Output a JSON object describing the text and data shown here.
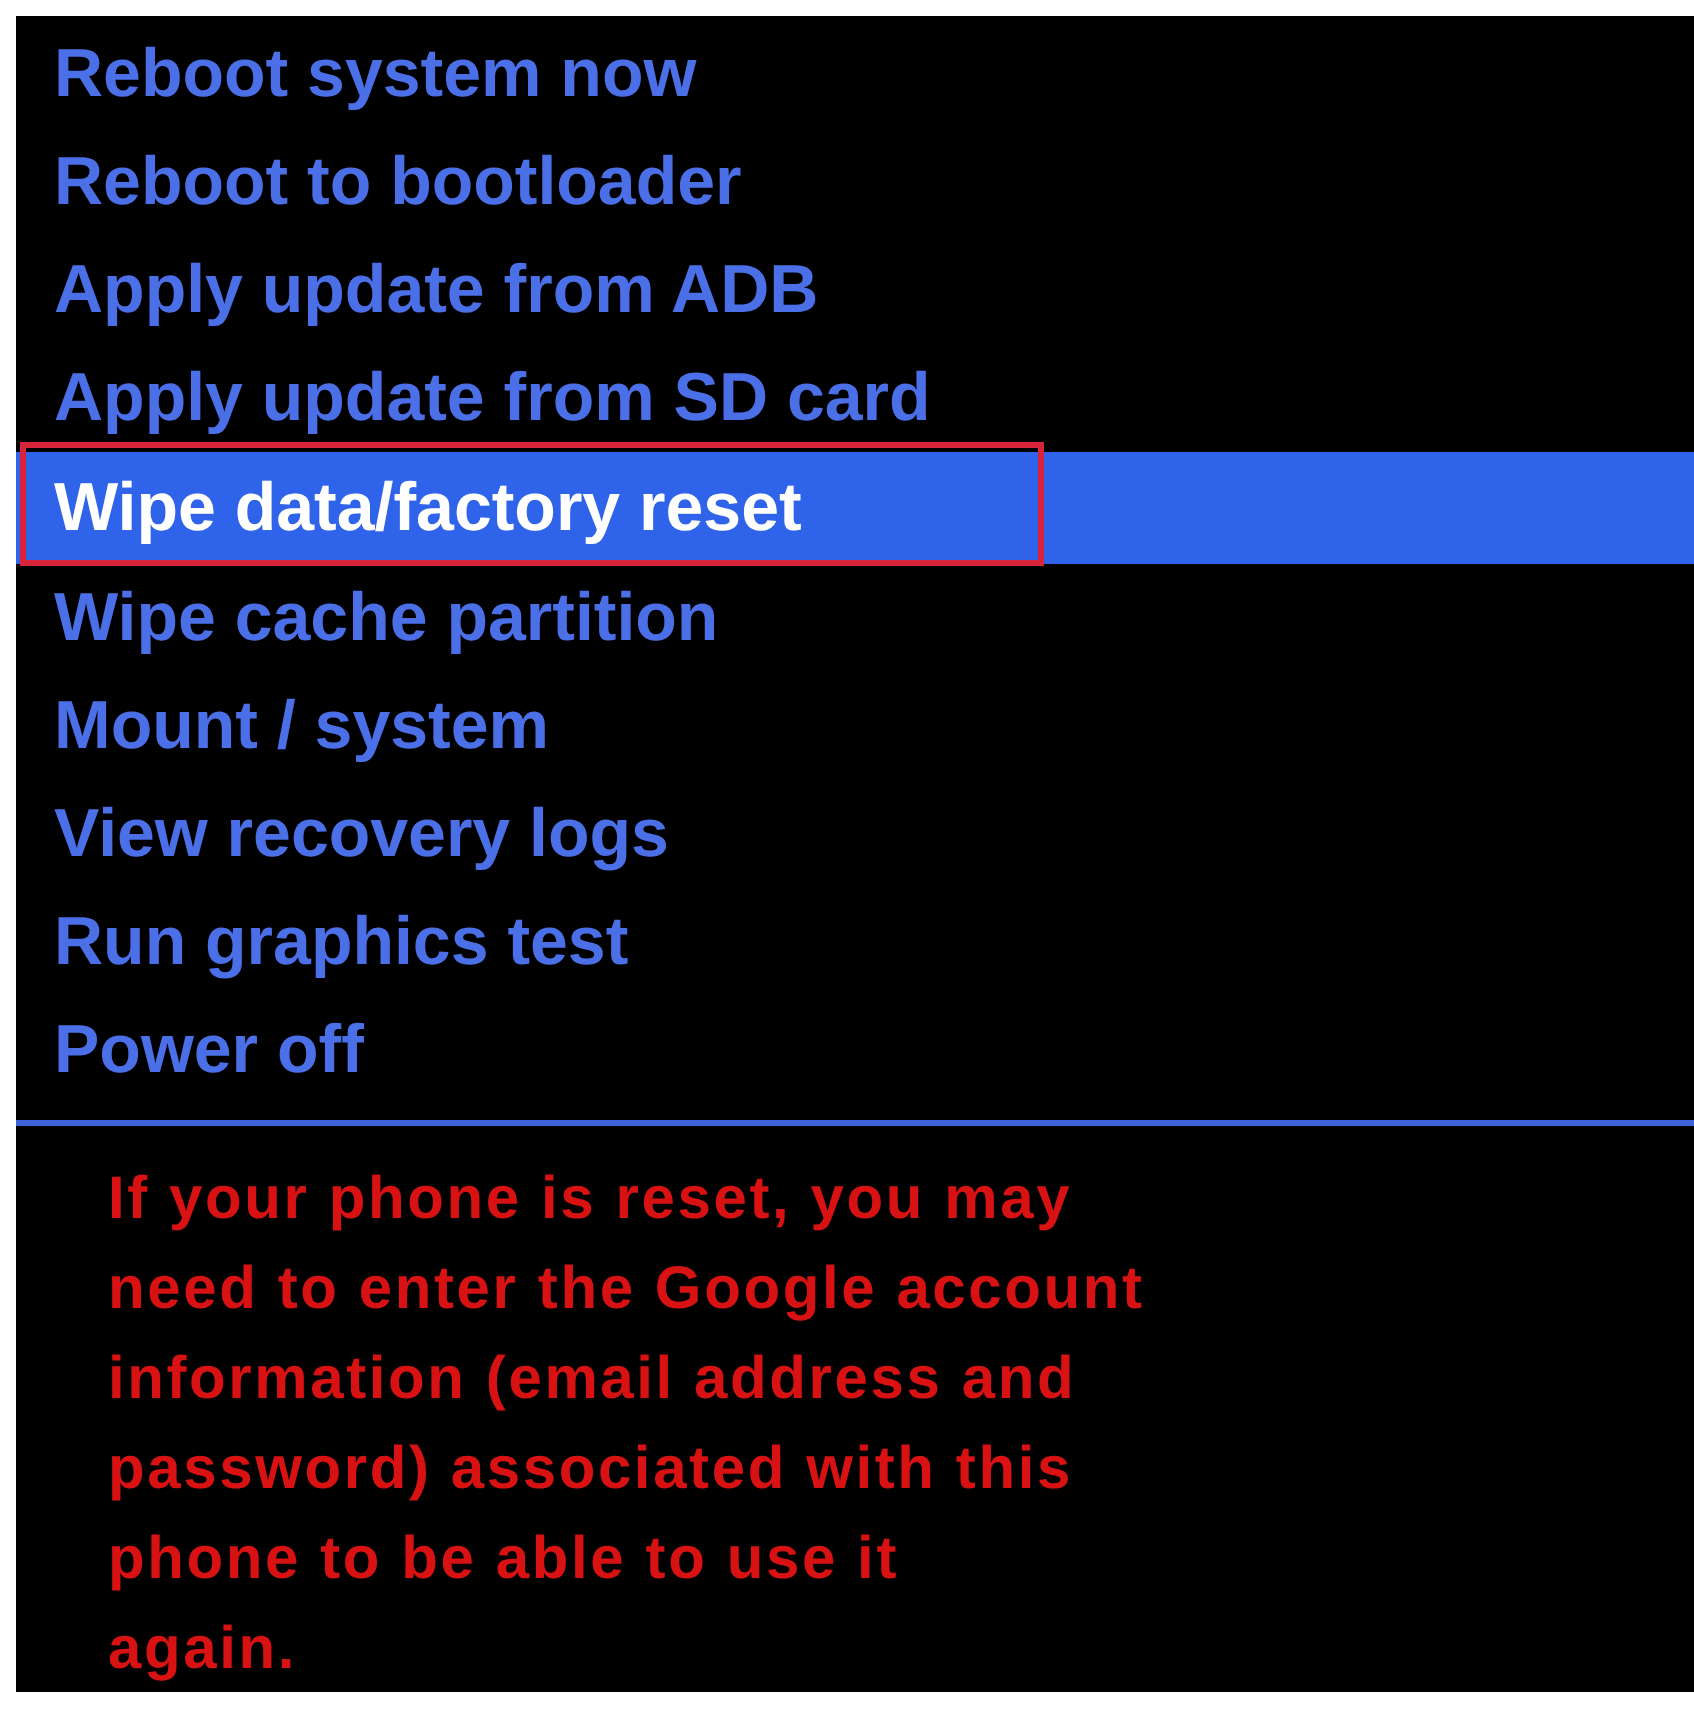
{
  "menu": {
    "items": [
      {
        "label": "Reboot system now",
        "selected": false
      },
      {
        "label": "Reboot to bootloader",
        "selected": false
      },
      {
        "label": "Apply update from ADB",
        "selected": false
      },
      {
        "label": "Apply update from SD card",
        "selected": false
      },
      {
        "label": "Wipe data/factory reset",
        "selected": true
      },
      {
        "label": "Wipe cache partition",
        "selected": false
      },
      {
        "label": "Mount / system",
        "selected": false
      },
      {
        "label": "View recovery logs",
        "selected": false
      },
      {
        "label": "Run graphics test",
        "selected": false
      },
      {
        "label": "Power off",
        "selected": false
      }
    ]
  },
  "warning": {
    "lines": [
      "If your phone is reset, you may",
      "need to enter the Google account",
      "information (email address and",
      "password) associated with this",
      "phone to be able to use it",
      "again."
    ]
  }
}
